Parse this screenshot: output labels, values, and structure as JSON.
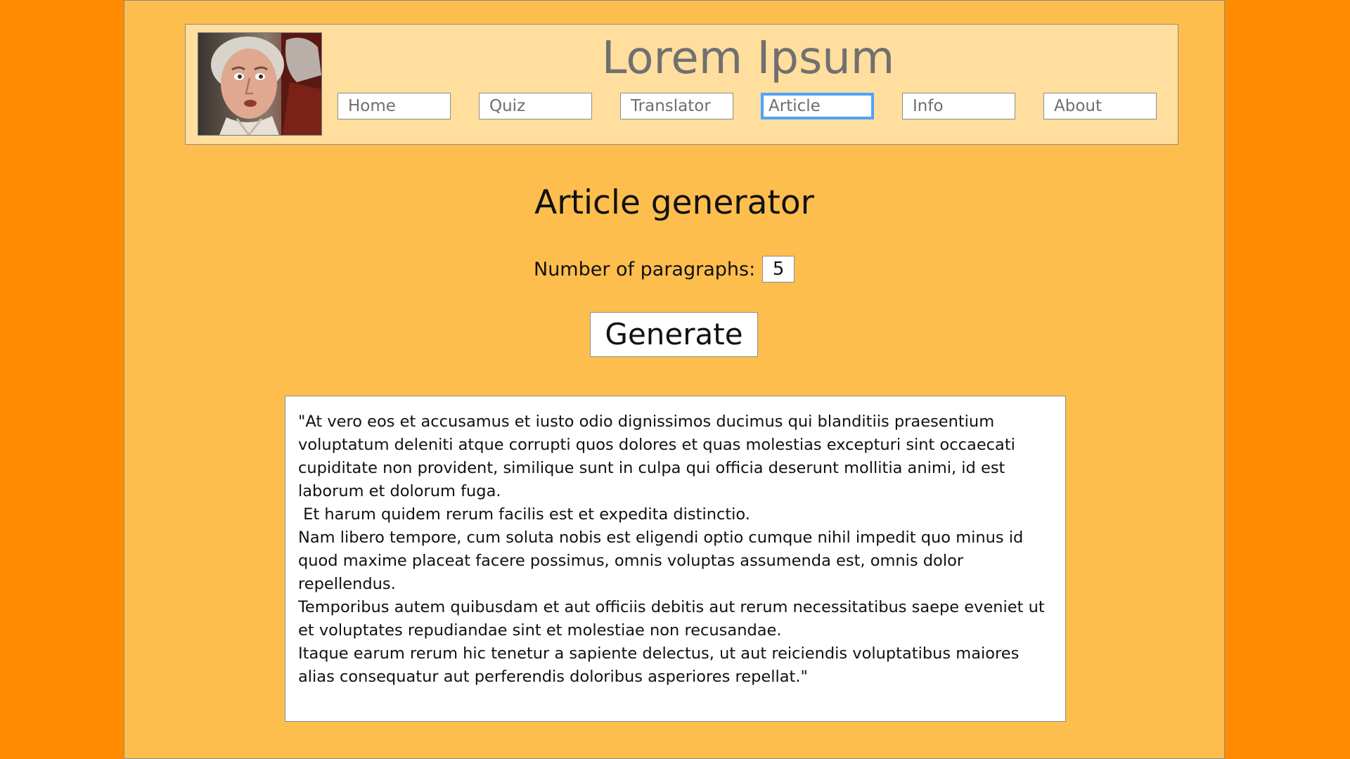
{
  "header": {
    "title": "Lorem Ipsum",
    "logo": "portrait-photo"
  },
  "nav": {
    "items": [
      {
        "label": "Home"
      },
      {
        "label": "Quiz"
      },
      {
        "label": "Translator"
      },
      {
        "label": "Article",
        "active": true
      },
      {
        "label": "Info"
      },
      {
        "label": "About"
      }
    ]
  },
  "main": {
    "heading": "Article generator",
    "paragraphs_label": "Number of paragraphs:",
    "paragraphs_value": "5",
    "generate_label": "Generate",
    "article_text": "\"At vero eos et accusamus et iusto odio dignissimos ducimus qui blanditiis praesentium voluptatum deleniti atque corrupti quos dolores et quas molestias excepturi sint occaecati cupiditate non provident, similique sunt in culpa qui officia deserunt mollitia animi, id est laborum et dolorum fuga.\n Et harum quidem rerum facilis est et expedita distinctio.\nNam libero tempore, cum soluta nobis est eligendi optio cumque nihil impedit quo minus id quod maxime placeat facere possimus, omnis voluptas assumenda est, omnis dolor repellendus.\nTemporibus autem quibusdam et aut officiis debitis aut rerum necessitatibus saepe eveniet ut et voluptates repudiandae sint et molestiae non recusandae.\nItaque earum rerum hic tenetur a sapiente delectus, ut aut reiciendis voluptatibus maiores alias consequatur aut perferendis doloribus asperiores repellat.\""
  },
  "colors": {
    "outer_background": "#FF8C00",
    "page_background": "#FDBE4E",
    "header_background": "#FFDE9E",
    "active_nav_border": "#4BA3FF"
  }
}
